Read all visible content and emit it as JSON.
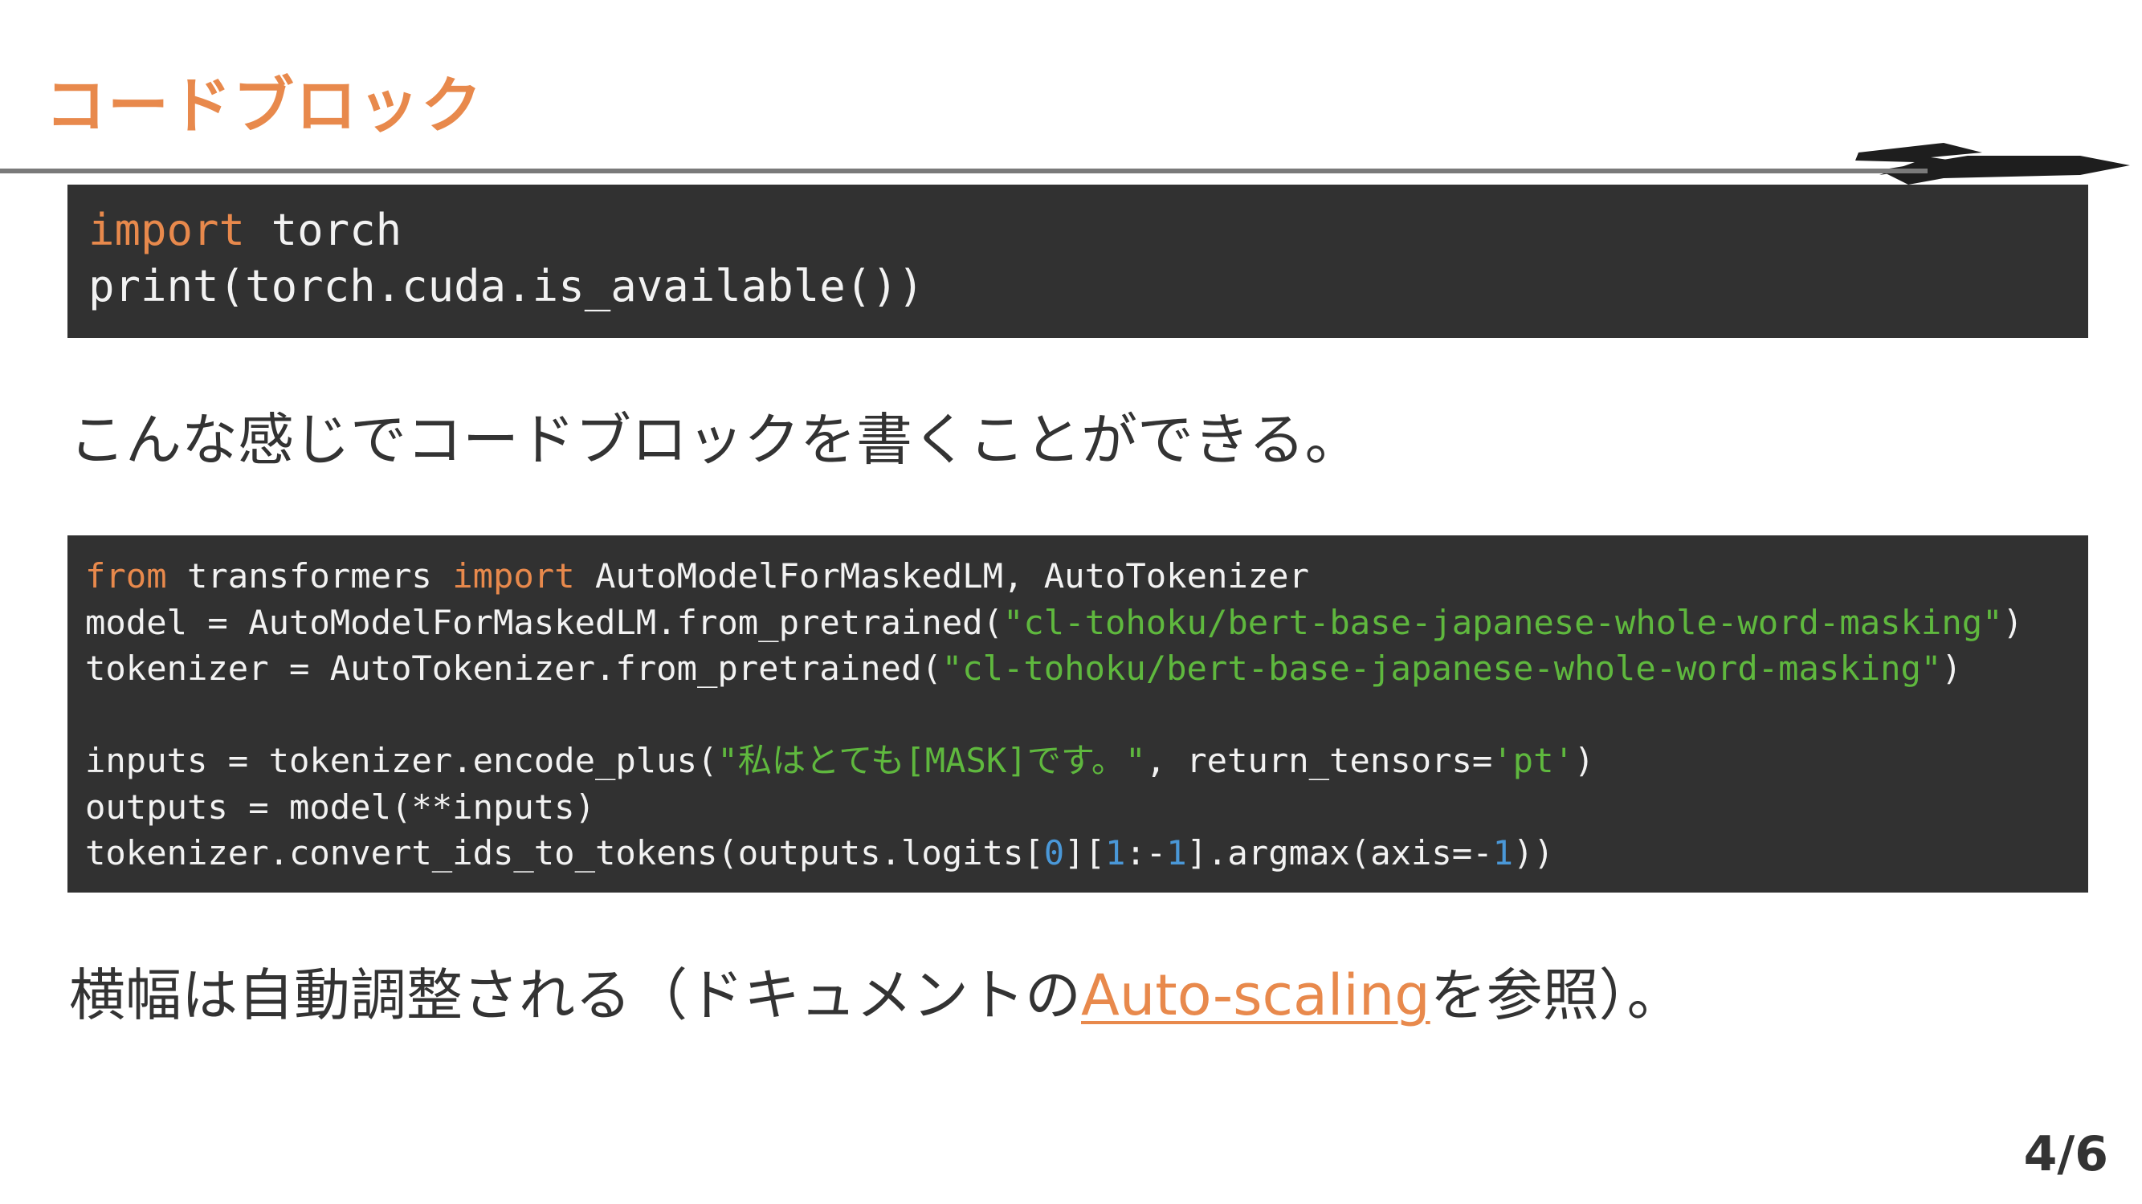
{
  "slide": {
    "title": "コードブロック",
    "page_number": "4/6",
    "accent_color": "#e8894c"
  },
  "code_block_1": {
    "language": "python",
    "lines": [
      [
        {
          "t": "import",
          "c": "kw"
        },
        {
          "t": " torch",
          "c": ""
        }
      ],
      [
        {
          "t": "print(torch.cuda.is_available())",
          "c": ""
        }
      ]
    ]
  },
  "paragraph_1": {
    "text": "こんな感じでコードブロックを書くことができる。"
  },
  "code_block_2": {
    "language": "python",
    "lines": [
      [
        {
          "t": "from",
          "c": "kw"
        },
        {
          "t": " transformers ",
          "c": ""
        },
        {
          "t": "import",
          "c": "kw"
        },
        {
          "t": " AutoModelForMaskedLM, AutoTokenizer",
          "c": ""
        }
      ],
      [
        {
          "t": "model = AutoModelForMaskedLM.from_pretrained(",
          "c": ""
        },
        {
          "t": "\"cl-tohoku/bert-base-japanese-whole-word-masking\"",
          "c": "str"
        },
        {
          "t": ")",
          "c": ""
        }
      ],
      [
        {
          "t": "tokenizer = AutoTokenizer.from_pretrained(",
          "c": ""
        },
        {
          "t": "\"cl-tohoku/bert-base-japanese-whole-word-masking\"",
          "c": "str"
        },
        {
          "t": ")",
          "c": ""
        }
      ],
      [],
      [
        {
          "t": "inputs = tokenizer.encode_plus(",
          "c": ""
        },
        {
          "t": "\"私はとても[MASK]です。\"",
          "c": "str"
        },
        {
          "t": ", return_tensors=",
          "c": ""
        },
        {
          "t": "'pt'",
          "c": "str"
        },
        {
          "t": ")",
          "c": ""
        }
      ],
      [
        {
          "t": "outputs = model(**inputs)",
          "c": ""
        }
      ],
      [
        {
          "t": "tokenizer.convert_ids_to_tokens(outputs.logits[",
          "c": ""
        },
        {
          "t": "0",
          "c": "num"
        },
        {
          "t": "][",
          "c": ""
        },
        {
          "t": "1",
          "c": "num"
        },
        {
          "t": ":-",
          "c": ""
        },
        {
          "t": "1",
          "c": "num"
        },
        {
          "t": "].argmax(axis=-",
          "c": ""
        },
        {
          "t": "1",
          "c": "num"
        },
        {
          "t": "))",
          "c": ""
        }
      ]
    ]
  },
  "paragraph_2": {
    "before": "横幅は自動調整される（ドキュメントの",
    "link_text": "Auto-scaling",
    "after": "を参照）。"
  }
}
